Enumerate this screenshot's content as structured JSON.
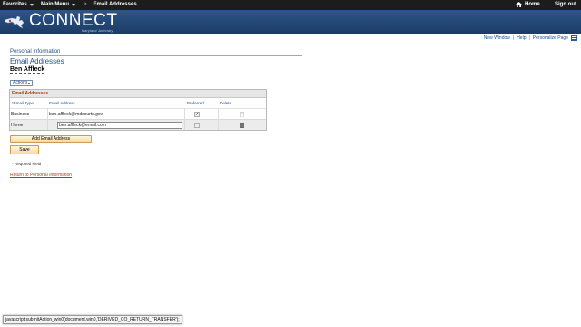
{
  "topnav": {
    "favorites": "Favorites",
    "main_menu": "Main Menu",
    "breadcrumb_sep": ">",
    "breadcrumb_current": "Email Addresses",
    "home": "Home",
    "sign_out": "Sign out"
  },
  "banner": {
    "wordmark": "CONNECT",
    "subline": "Maryland Judiciary"
  },
  "toplinks": {
    "new_window": "New Window",
    "sep": "|",
    "help": "Help",
    "personalize": "Personalize Page"
  },
  "page": {
    "section_label": "Personal Information",
    "title": "Email Addresses",
    "person_name": "Ben Affleck",
    "actions": "Actions"
  },
  "grid": {
    "caption": "Email Addresses",
    "headers": {
      "type": "*Email Type",
      "address": "Email Address",
      "preferred": "Preferred",
      "delete": "Delete"
    },
    "rows": [
      {
        "type": "Business",
        "address": "ben.affleck@mdcourts.gov",
        "preferred": true,
        "delete_enabled": false
      },
      {
        "type": "Home",
        "address": "ben.affleck@email.com",
        "preferred": false,
        "delete_enabled": true
      }
    ]
  },
  "buttons": {
    "add_email": "Add Email Address",
    "save": "Save"
  },
  "required_note": "* Required Field",
  "return_link": "Return to Personal Information",
  "statusbar": "javascript:submitAction_win0(document.win0,'DERIVED_CO_RETURN_TRANSFER');",
  "colors": {
    "banner": "#2d5687",
    "link": "#1f4f8a",
    "caption_text": "#a0421a",
    "button": "#f7d9a6"
  }
}
